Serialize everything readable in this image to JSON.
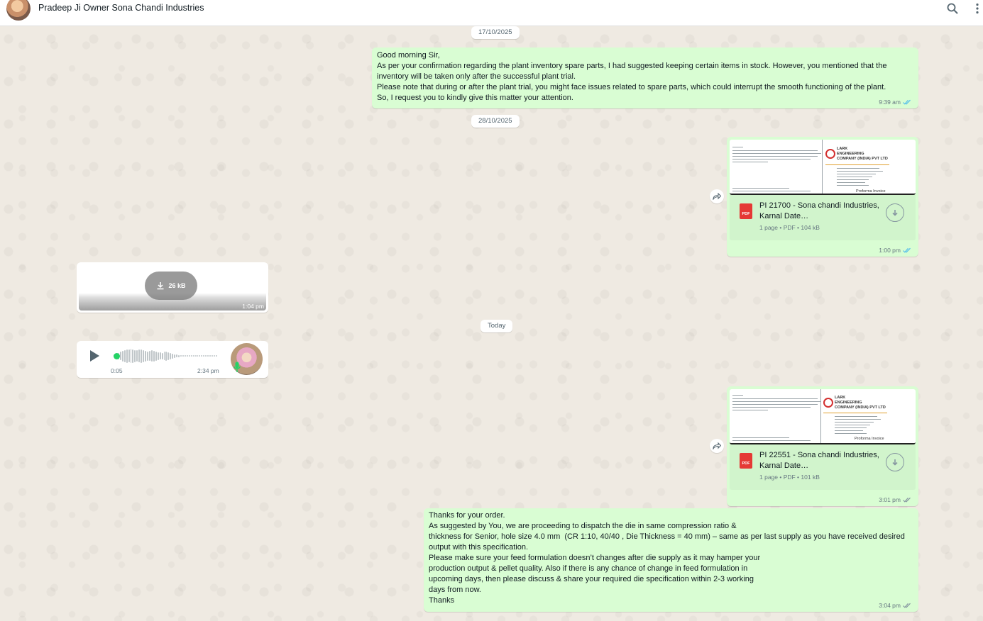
{
  "header": {
    "contact_name": "Pradeep Ji Owner Sona Chandi Industries"
  },
  "dates": {
    "d1": "17/10/2025",
    "d2": "28/10/2025",
    "d3": "Today"
  },
  "messages": {
    "m1": {
      "text": "Good morning Sir,\nAs per your confirmation regarding the plant inventory spare parts, I had suggested keeping certain items in stock. However, you mentioned that the\ninventory will be taken only after the successful plant trial.\nPlease note that during or after the plant trial, you might face issues related to spare parts, which could interrupt the smooth functioning of the plant.\nSo, I request you to kindly give this matter your attention.",
      "time": "9:39 am"
    },
    "doc1": {
      "name": "PI 21700 - Sona chandi Industries, Karnal Date…",
      "info": "1 page • PDF • 104 kB",
      "pdf_label": "PDF",
      "preview_company": "LARK\nENGINEERING\nCOMPANY (INDIA) PVT LTD",
      "preview_label": "Proforma Invoice",
      "time": "1:00 pm"
    },
    "video": {
      "size": "26 kB",
      "time": "1:04 pm"
    },
    "voice": {
      "duration": "0:05",
      "time": "2:34 pm"
    },
    "doc2": {
      "name": "PI 22551 - Sona chandi Industries, Karnal Date…",
      "info": "1 page • PDF • 101 kB",
      "pdf_label": "PDF",
      "preview_company": "LARK\nENGINEERING\nCOMPANY (INDIA) PVT LTD",
      "preview_label": "Proforma Invoice",
      "time": "3:01 pm"
    },
    "m2": {
      "text": "Thanks for your order.\nAs suggested by You, we are proceeding to dispatch the die in same compression ratio &\nthickness for Senior, hole size 4.0 mm  (CR 1:10, 40/40 , Die Thickness = 40 mm) – same as per last supply as you have received desired\noutput with this specification.\nPlease make sure your feed formulation doesn’t changes after die supply as it may hamper your\nproduction output & pellet quality. Also if there is any chance of change in feed formulation in\nupcoming days, then please discuss & share your required die specification within 2-3 working\ndays from now.\nThanks",
      "time": "3:04 pm"
    }
  },
  "icons": {
    "search": "search-icon",
    "menu": "kebab-menu-icon",
    "forward": "forward-icon",
    "download": "download-icon",
    "play": "play-icon",
    "mic": "microphone-icon",
    "tick": "double-check-icon"
  },
  "colors": {
    "outgoing_bubble": "#d9fdd3",
    "incoming_bubble": "#ffffff",
    "chat_background": "#efeae2",
    "read_tick": "#53bdeb",
    "delivered_tick": "#8696a0",
    "voice_dot": "#25d366",
    "pdf_red": "#e53935"
  }
}
